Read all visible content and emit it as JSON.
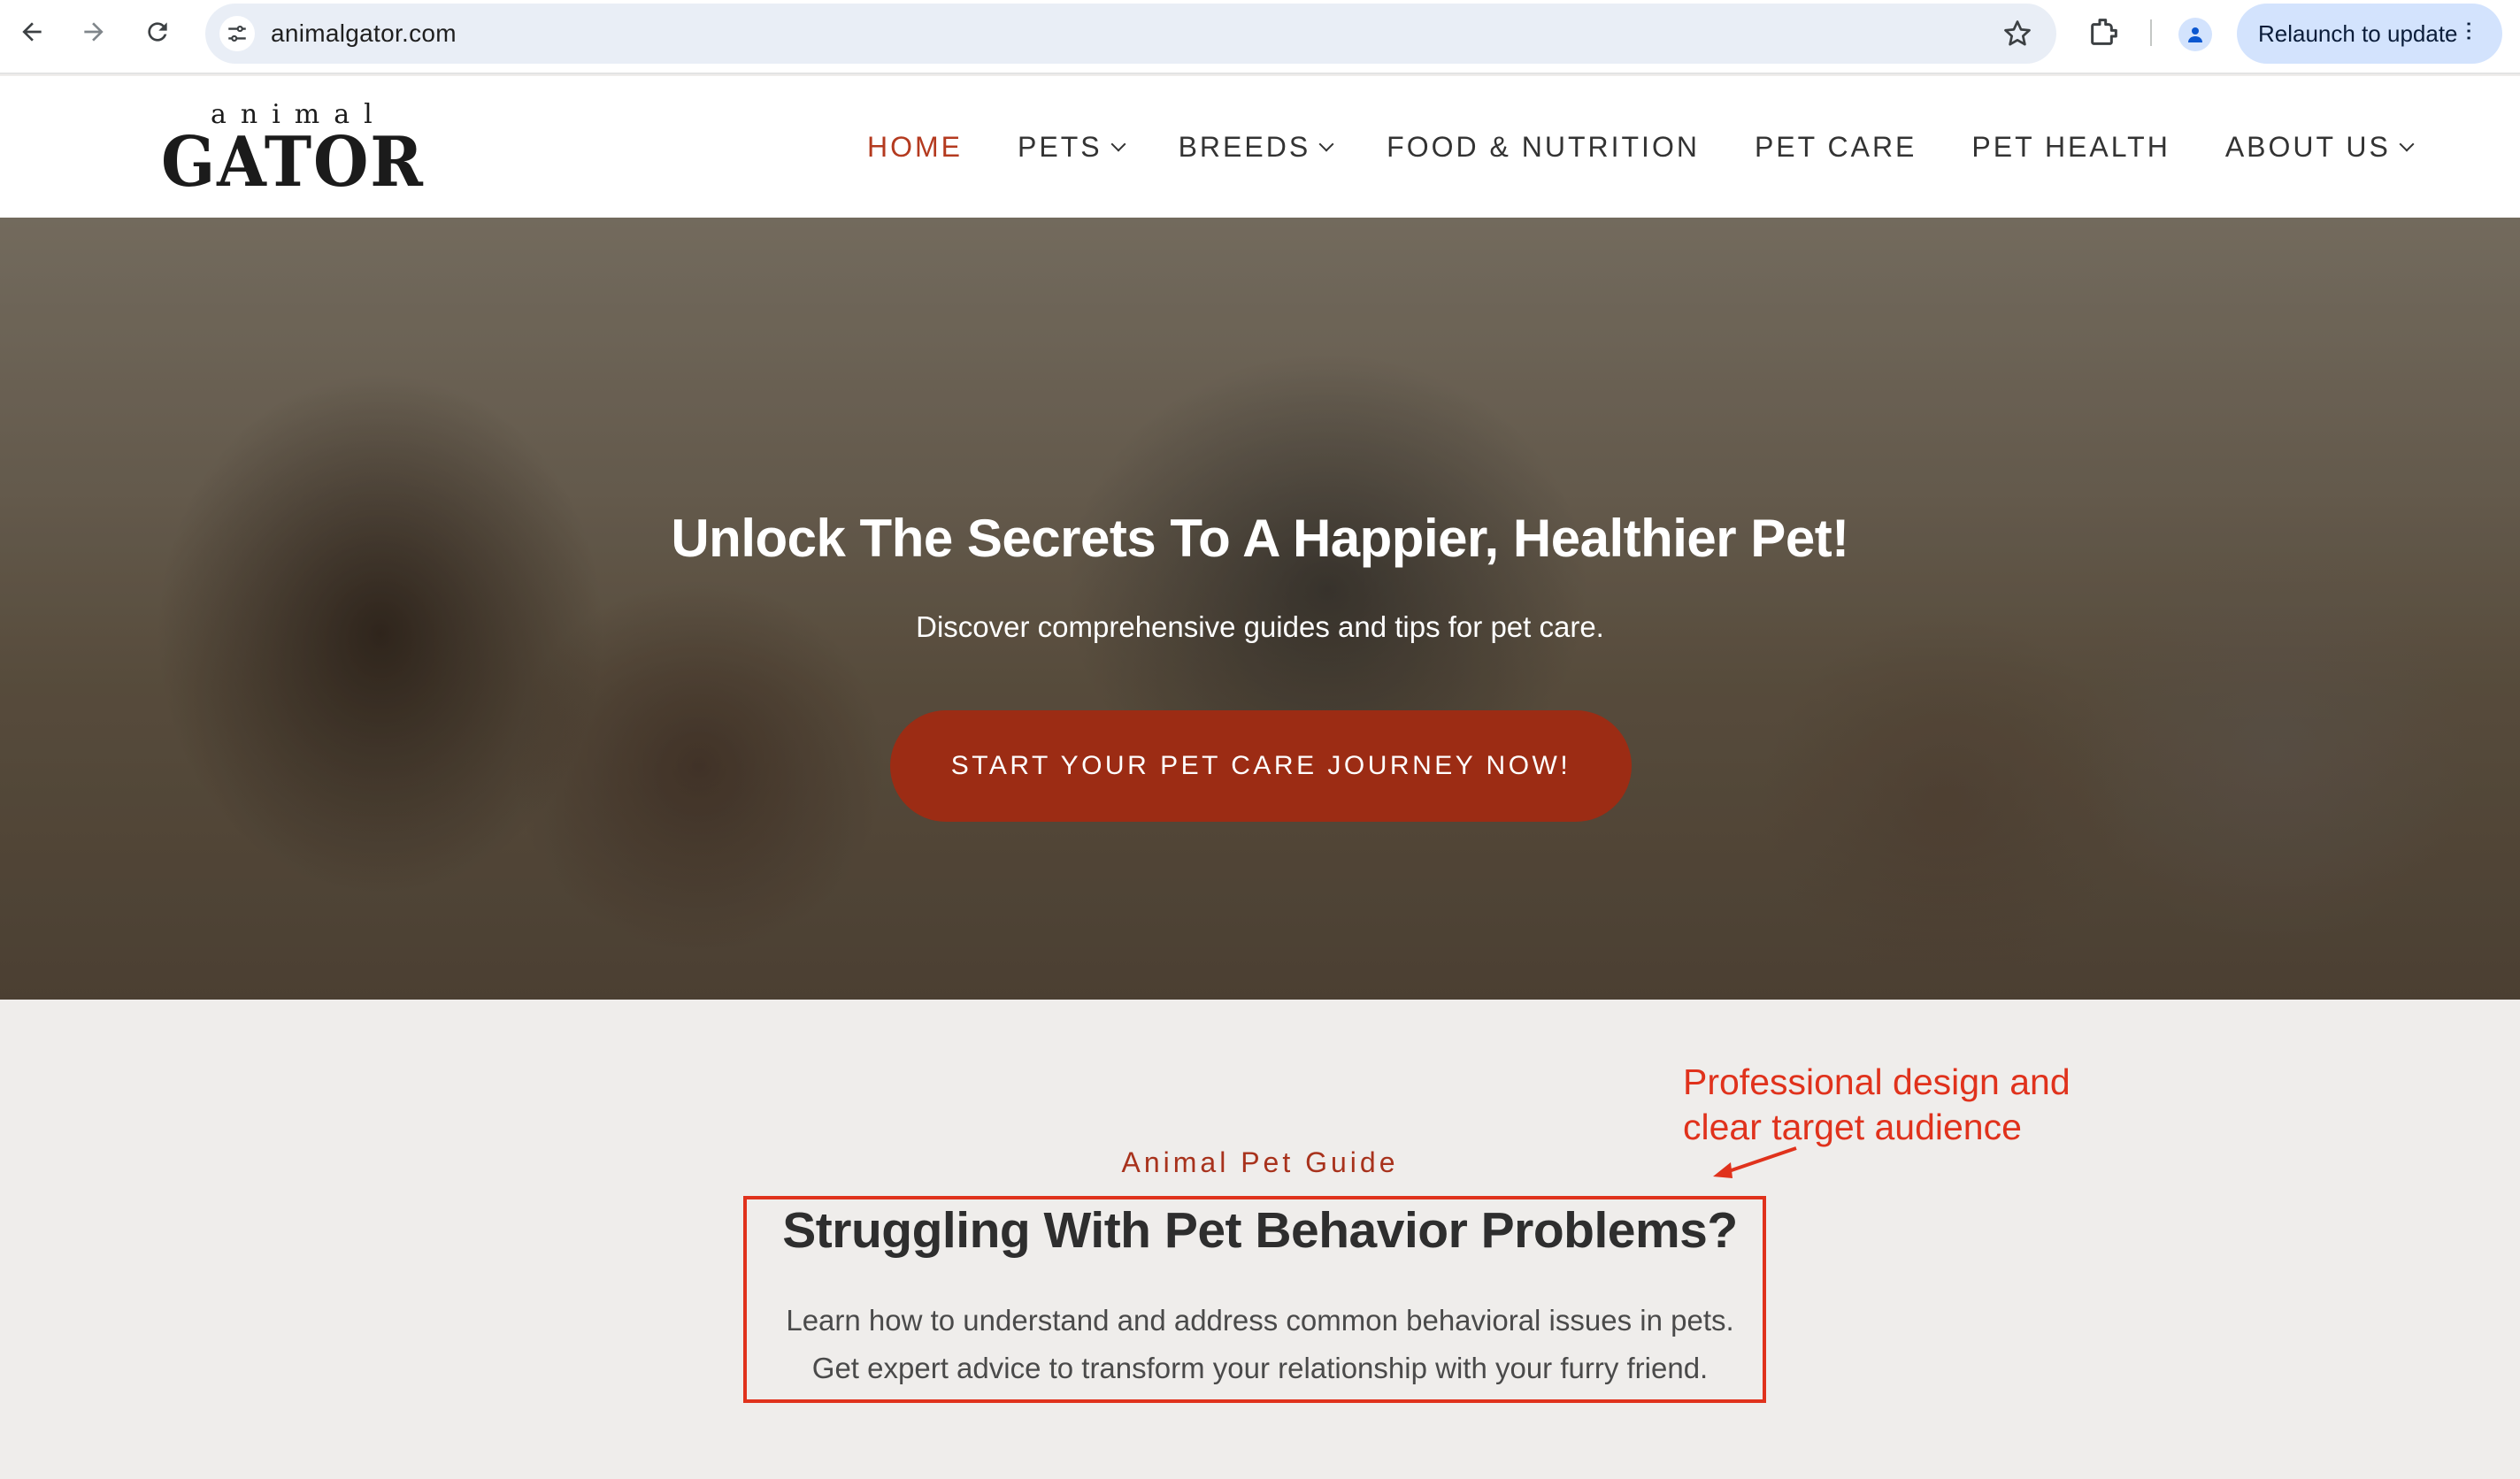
{
  "browser": {
    "url": "animalgator.com",
    "relaunch_label": "Relaunch to update"
  },
  "site": {
    "logo_small": "animal",
    "logo_big": "GATOR",
    "menu": [
      {
        "label": "HOME",
        "active": true,
        "dropdown": false
      },
      {
        "label": "PETS",
        "active": false,
        "dropdown": true
      },
      {
        "label": "BREEDS",
        "active": false,
        "dropdown": true
      },
      {
        "label": "FOOD & NUTRITION",
        "active": false,
        "dropdown": false
      },
      {
        "label": "PET CARE",
        "active": false,
        "dropdown": false
      },
      {
        "label": "PET HEALTH",
        "active": false,
        "dropdown": false
      },
      {
        "label": "ABOUT US",
        "active": false,
        "dropdown": true
      }
    ],
    "accent_color": "#9c2c14"
  },
  "hero": {
    "title": "Unlock The Secrets To A Happier, Healthier Pet!",
    "subtitle": "Discover comprehensive guides and tips for pet care.",
    "cta": "START YOUR PET CARE JOURNEY NOW!"
  },
  "content": {
    "eyebrow": "Animal Pet Guide",
    "title": "Struggling With Pet Behavior Problems?",
    "line1": "Learn how to understand and address common behavioral issues in pets.",
    "line2": "Get expert advice to transform your relationship with your furry friend."
  },
  "annotation": {
    "line1": "Professional design and",
    "line2": "clear target audience",
    "color": "#e0321c"
  }
}
